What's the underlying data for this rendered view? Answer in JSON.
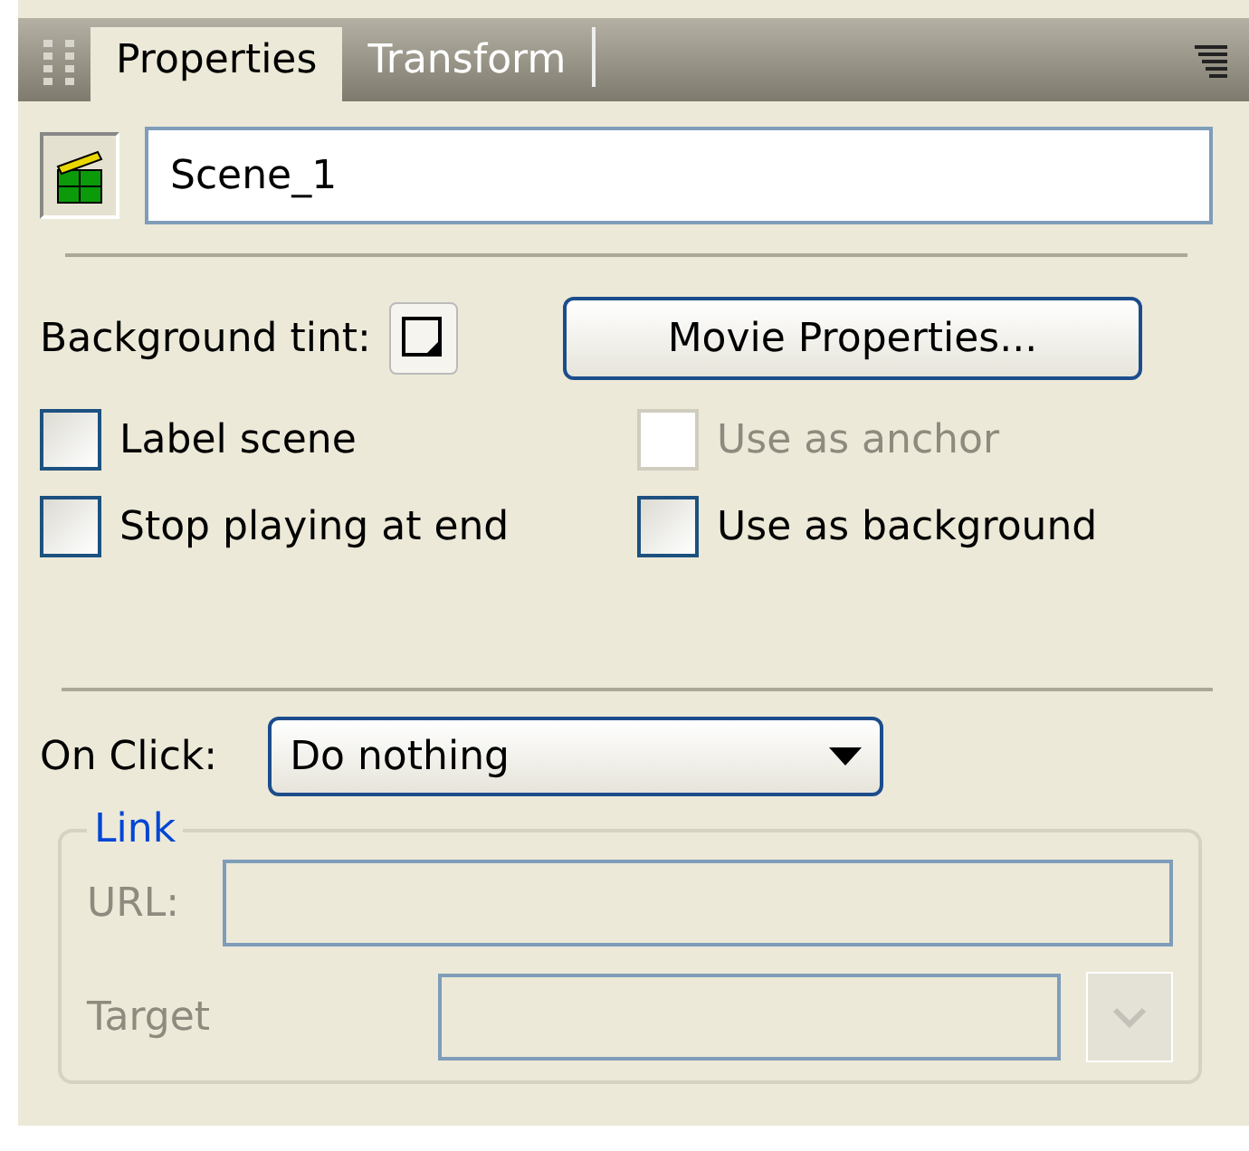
{
  "tabs": [
    {
      "label": "Properties",
      "selected": true
    },
    {
      "label": "Transform",
      "selected": false
    }
  ],
  "scene_name": {
    "value": "Scene_1"
  },
  "background_tint": {
    "label": "Background tint:"
  },
  "movie_properties_button": {
    "label": "Movie Properties..."
  },
  "checkboxes": [
    {
      "label": "Label scene",
      "checked": false,
      "disabled": false
    },
    {
      "label": "Use as anchor",
      "checked": false,
      "disabled": true
    },
    {
      "label": "Stop playing at end",
      "checked": false,
      "disabled": false
    },
    {
      "label": "Use as background",
      "checked": false,
      "disabled": false
    }
  ],
  "on_click": {
    "label": "On Click:",
    "value": "Do nothing"
  },
  "link": {
    "legend": "Link",
    "url_label": "URL:",
    "target_label": "Target",
    "disabled": true
  }
}
